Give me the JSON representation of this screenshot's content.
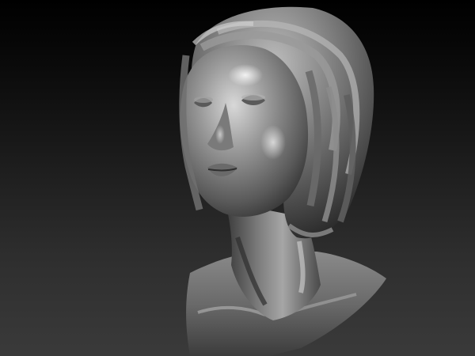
{
  "viewport": {
    "background_top": "#000000",
    "background_bottom": "#3a3a3a",
    "material_color": "#8c8c8c",
    "highlight_color": "#e6e6e6",
    "shadow_color": "#1a1a1a"
  },
  "model": {
    "subject": "sculpted-bust-icon"
  }
}
